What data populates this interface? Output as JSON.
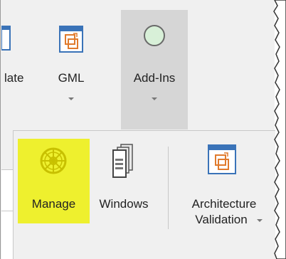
{
  "ribbon": {
    "partial_button_label": "late",
    "gml_label": "GML",
    "addins_label": "Add-Ins"
  },
  "flyout": {
    "manage_label": "Manage",
    "windows_label": "Windows",
    "architecture_label_line1": "Architecture",
    "architecture_label_line2": "Validation"
  },
  "colors": {
    "ribbon_bg": "#f0f0f0",
    "highlight_pressed": "#d6d6d6",
    "highlight_manage": "#eef02e",
    "icon_blue": "#3a73b8",
    "icon_orange": "#e07a2c"
  },
  "icons": {
    "partial": "document-icon",
    "gml": "gml-transform-icon",
    "addins": "addins-circle-icon",
    "manage": "manage-wheel-icon",
    "windows": "windows-stack-icon",
    "architecture": "architecture-validation-icon"
  }
}
